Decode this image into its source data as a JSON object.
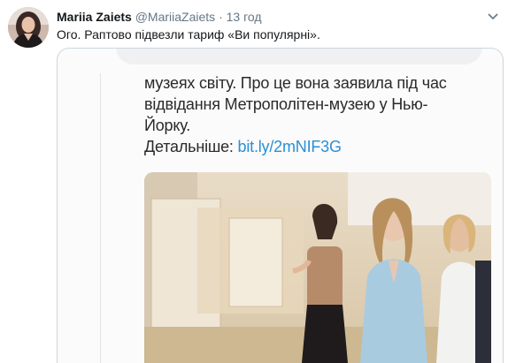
{
  "tweet": {
    "name": "Mariia Zaiets",
    "handle": "@MariiaZaiets",
    "dot": "·",
    "time": "13 год",
    "text": "Ого. Раптово підвезли тариф «Ви популярні».",
    "caret_icon": "chevron-down-icon"
  },
  "screenshot": {
    "line1": "музеях світу. Про це вона заявила під час",
    "line2": "відвідання Метрополітен-музею у Нью-",
    "line3": "Йорку.",
    "detail_label": "Детальніше:",
    "detail_link": "bit.ly/2mNIF3G"
  },
  "colors": {
    "link": "#2b8fd6",
    "name": "#14171a",
    "muted": "#657786",
    "border": "#ccd6dd"
  }
}
